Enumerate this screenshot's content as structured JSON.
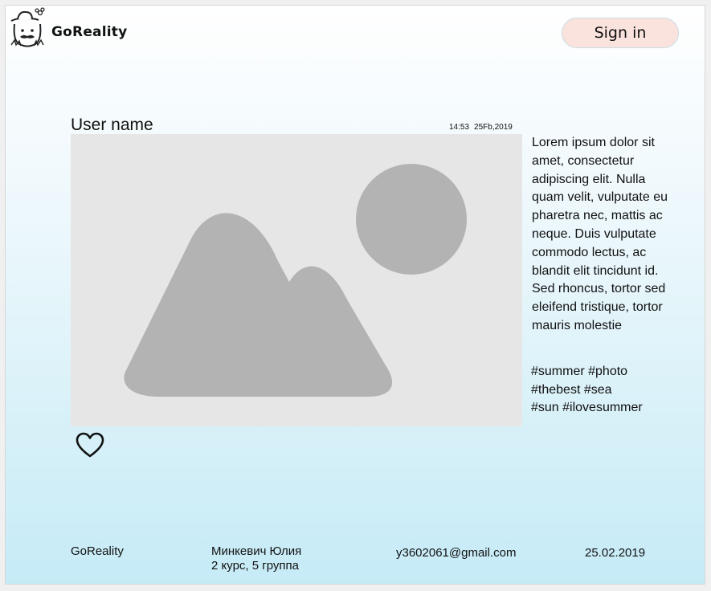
{
  "header": {
    "brand": "GoReality",
    "sign_in_label": "Sign in"
  },
  "post": {
    "user_name": "User name",
    "time": "14:53",
    "date": "25Fb,2019",
    "description": "Lorem ipsum dolor sit amet, consectetur adipiscing elit. Nulla quam velit, vulputate eu pharetra nec, mattis ac neque. Duis vulputate commodo lectus, ac blandit elit tincidunt id. Sed rhoncus, tortor sed eleifend tristique, tortor mauris molestie",
    "hashtags": [
      "#summer #photo",
      "#thebest #sea",
      "#sun #ilovesummer"
    ],
    "image_icon": "image-placeholder-icon",
    "like_icon": "heart-icon"
  },
  "footer": {
    "brand": "GoReality",
    "author_name": "Минкевич Юлия",
    "author_group": "2 курс, 5 группа",
    "email": "y3602061@gmail.com",
    "date": "25.02.2019"
  },
  "colors": {
    "sign_in_bg": "#fbe3dd",
    "placeholder_bg": "#e6e6e6",
    "placeholder_shape": "#b3b3b3",
    "page_gradient_bottom": "#c6ebf7"
  }
}
